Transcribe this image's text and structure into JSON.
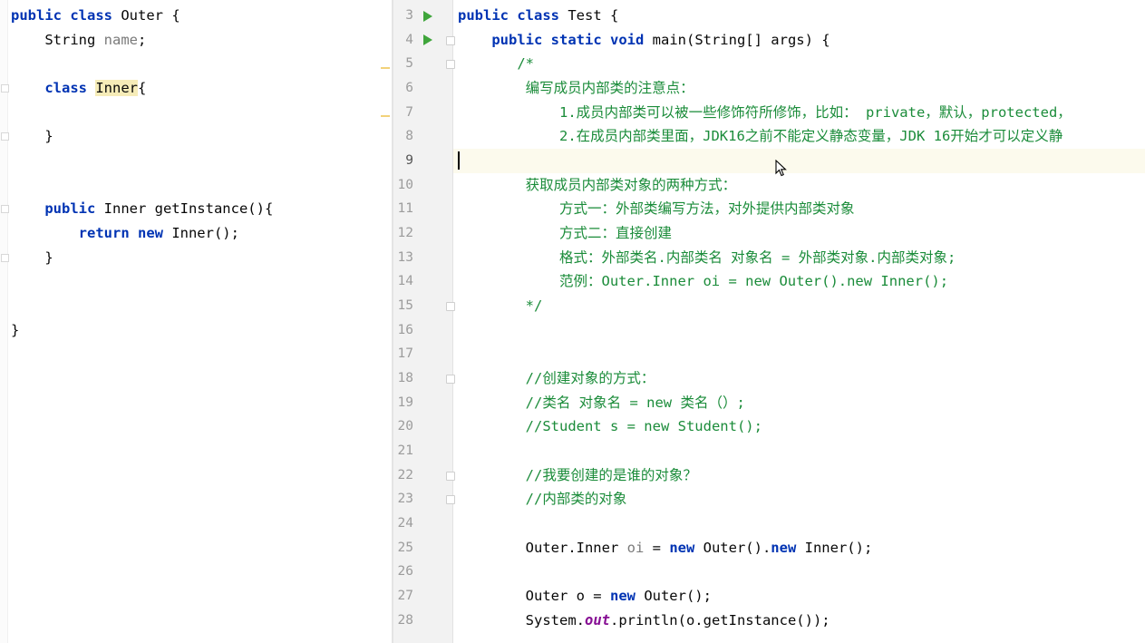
{
  "left_editor": {
    "lines": [
      {
        "tokens": [
          {
            "t": "public ",
            "c": "kw"
          },
          {
            "t": "class ",
            "c": "kw"
          },
          {
            "t": "Outer {",
            "c": "plain"
          }
        ]
      },
      {
        "tokens": [
          {
            "t": "    String ",
            "c": "plain"
          },
          {
            "t": "name",
            "c": "grayvar"
          },
          {
            "t": ";",
            "c": "plain"
          }
        ]
      },
      {
        "tokens": []
      },
      {
        "tokens": [
          {
            "t": "    ",
            "c": "plain"
          },
          {
            "t": "class ",
            "c": "kw"
          },
          {
            "t": "Inner",
            "c": "hl"
          },
          {
            "t": "{",
            "c": "plain"
          }
        ]
      },
      {
        "tokens": []
      },
      {
        "tokens": [
          {
            "t": "    }",
            "c": "plain"
          }
        ]
      },
      {
        "tokens": []
      },
      {
        "tokens": []
      },
      {
        "tokens": [
          {
            "t": "    ",
            "c": "plain"
          },
          {
            "t": "public ",
            "c": "kw"
          },
          {
            "t": "Inner getInstance(){",
            "c": "plain"
          }
        ]
      },
      {
        "tokens": [
          {
            "t": "        ",
            "c": "plain"
          },
          {
            "t": "return ",
            "c": "kw"
          },
          {
            "t": "new ",
            "c": "kw"
          },
          {
            "t": "Inner();",
            "c": "plain"
          }
        ]
      },
      {
        "tokens": [
          {
            "t": "    }",
            "c": "plain"
          }
        ]
      },
      {
        "tokens": []
      },
      {
        "tokens": []
      },
      {
        "tokens": [
          {
            "t": "}",
            "c": "plain"
          }
        ]
      }
    ]
  },
  "right_editor": {
    "lines": [
      {
        "num": "3",
        "run": true,
        "tokens": [
          {
            "t": "public ",
            "c": "kw"
          },
          {
            "t": "class ",
            "c": "kw"
          },
          {
            "t": "Test {",
            "c": "plain"
          }
        ]
      },
      {
        "num": "4",
        "run": true,
        "fold": true,
        "tokens": [
          {
            "t": "    ",
            "c": "plain"
          },
          {
            "t": "public ",
            "c": "kw"
          },
          {
            "t": "static ",
            "c": "kw"
          },
          {
            "t": "void ",
            "c": "kw"
          },
          {
            "t": "main(String[] args) {",
            "c": "plain"
          }
        ]
      },
      {
        "num": "5",
        "fold": true,
        "tokens": [
          {
            "t": "       /*",
            "c": "cmt"
          }
        ]
      },
      {
        "num": "6",
        "tokens": [
          {
            "t": "        编写成员内部类的注意点：",
            "c": "cmt"
          }
        ]
      },
      {
        "num": "7",
        "tokens": [
          {
            "t": "            1.成员内部类可以被一些修饰符所修饰，比如： private，默认，protected，",
            "c": "cmt"
          }
        ]
      },
      {
        "num": "8",
        "tokens": [
          {
            "t": "            2.在成员内部类里面，JDK16之前不能定义静态变量，JDK 16开始才可以定义静",
            "c": "cmt"
          }
        ]
      },
      {
        "num": "9",
        "current": true,
        "tokens": []
      },
      {
        "num": "10",
        "tokens": [
          {
            "t": "        获取成员内部类对象的两种方式：",
            "c": "cmt"
          }
        ]
      },
      {
        "num": "11",
        "tokens": [
          {
            "t": "            方式一：外部类编写方法，对外提供内部类对象",
            "c": "cmt"
          }
        ]
      },
      {
        "num": "12",
        "tokens": [
          {
            "t": "            方式二：直接创建",
            "c": "cmt"
          }
        ]
      },
      {
        "num": "13",
        "tokens": [
          {
            "t": "            格式：外部类名.内部类名 对象名 = 外部类对象.内部类对象;",
            "c": "cmt"
          }
        ]
      },
      {
        "num": "14",
        "tokens": [
          {
            "t": "            范例：Outer.Inner oi = new Outer().new Inner();",
            "c": "cmt"
          }
        ]
      },
      {
        "num": "15",
        "fold": true,
        "tokens": [
          {
            "t": "        */",
            "c": "cmt"
          }
        ]
      },
      {
        "num": "16",
        "tokens": []
      },
      {
        "num": "17",
        "tokens": []
      },
      {
        "num": "18",
        "fold": true,
        "tokens": [
          {
            "t": "        //创建对象的方式：",
            "c": "cmt"
          }
        ]
      },
      {
        "num": "19",
        "tokens": [
          {
            "t": "        //类名 对象名 = new 类名（）;",
            "c": "cmt"
          }
        ]
      },
      {
        "num": "20",
        "tokens": [
          {
            "t": "        //Student s = new Student();",
            "c": "cmt"
          }
        ]
      },
      {
        "num": "21",
        "tokens": []
      },
      {
        "num": "22",
        "fold": true,
        "tokens": [
          {
            "t": "        //我要创建的是谁的对象？",
            "c": "cmt"
          }
        ]
      },
      {
        "num": "23",
        "fold": true,
        "tokens": [
          {
            "t": "        //内部类的对象",
            "c": "cmt"
          }
        ]
      },
      {
        "num": "24",
        "tokens": []
      },
      {
        "num": "25",
        "tokens": [
          {
            "t": "        Outer.Inner ",
            "c": "plain"
          },
          {
            "t": "oi",
            "c": "grayvar"
          },
          {
            "t": " = ",
            "c": "plain"
          },
          {
            "t": "new ",
            "c": "kw"
          },
          {
            "t": "Outer().",
            "c": "plain"
          },
          {
            "t": "new ",
            "c": "kw"
          },
          {
            "t": "Inner();",
            "c": "plain"
          }
        ]
      },
      {
        "num": "26",
        "tokens": []
      },
      {
        "num": "27",
        "tokens": [
          {
            "t": "        Outer o = ",
            "c": "plain"
          },
          {
            "t": "new ",
            "c": "kw"
          },
          {
            "t": "Outer();",
            "c": "plain"
          }
        ]
      },
      {
        "num": "28",
        "tokens": [
          {
            "t": "        System.",
            "c": "plain"
          },
          {
            "t": "out",
            "c": "italicfield"
          },
          {
            "t": ".println(o.getInstance());",
            "c": "plain"
          }
        ]
      }
    ]
  }
}
